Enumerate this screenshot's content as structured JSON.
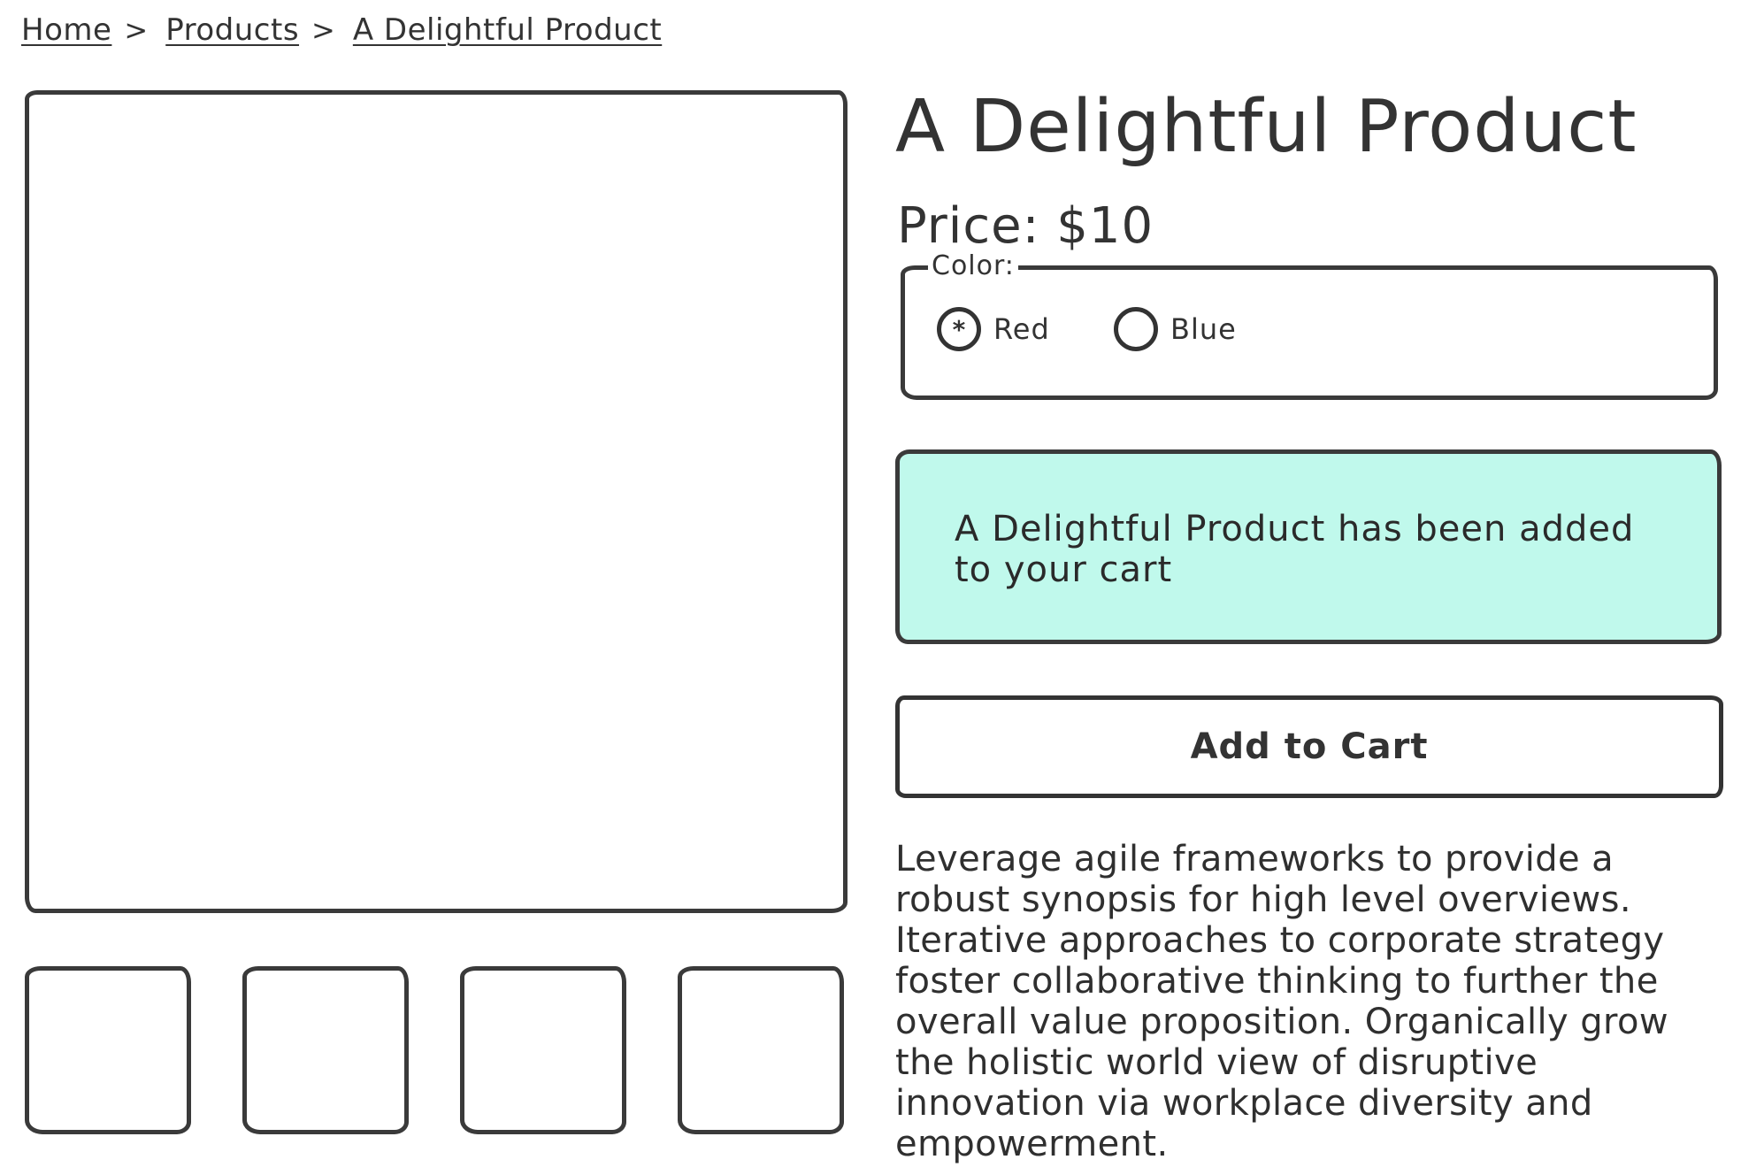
{
  "breadcrumb": {
    "items": [
      {
        "label": "Home"
      },
      {
        "label": "Products"
      },
      {
        "label": "A Delightful Product"
      }
    ],
    "separator": ">"
  },
  "product": {
    "title": "A Delightful Product",
    "price_label": "Price: $10",
    "color_legend": "Color:",
    "color_options": [
      {
        "label": "Red",
        "selected": true,
        "marker": "*"
      },
      {
        "label": "Blue",
        "selected": false,
        "marker": ""
      }
    ],
    "cart_message": "A Delightful Product has been added to your cart",
    "alert_color": "#c0f9ec",
    "add_to_cart_label": "Add to Cart",
    "description": "Leverage agile frameworks to provide a robust synopsis for high level overviews. Iterative approaches to corporate strategy foster collaborative thinking to further the overall value proposition. Organically grow the holistic world view of disruptive innovation via workplace diversity and empowerment."
  },
  "gallery": {
    "thumbnail_count": 4
  }
}
